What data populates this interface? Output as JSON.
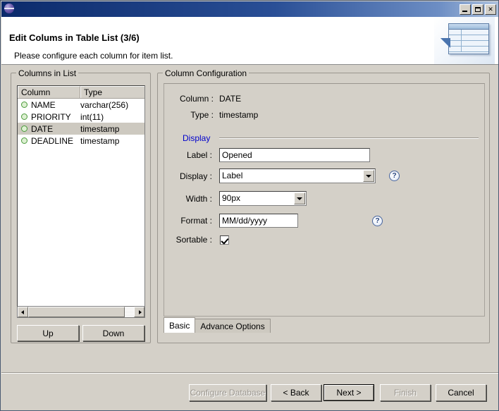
{
  "window": {
    "icon": "eclipse-globe-icon",
    "controls": {
      "minimize": "minimize-icon",
      "maximize": "maximize-icon",
      "close": "✕"
    }
  },
  "header": {
    "title": "Edit Colums in Table List (3/6)",
    "subtitle": "Please configure each column for item list.",
    "art": "table-wizard-banner-icon"
  },
  "columns_group": {
    "legend": "Columns in List",
    "table": {
      "headers": [
        "Column",
        "Type"
      ],
      "rows": [
        {
          "name": "NAME",
          "type": "varchar(256)",
          "selected": false
        },
        {
          "name": "PRIORITY",
          "type": "int(11)",
          "selected": false
        },
        {
          "name": "DATE",
          "type": "timestamp",
          "selected": true
        },
        {
          "name": "DEADLINE",
          "type": "timestamp",
          "selected": false
        }
      ]
    },
    "buttons": {
      "up": "Up",
      "down": "Down"
    }
  },
  "config_group": {
    "legend": "Column Configuration",
    "column_label": "Column :",
    "column_value": "DATE",
    "type_label": "Type :",
    "type_value": "timestamp",
    "display_section": "Display",
    "fields": {
      "label_label": "Label :",
      "label_value": "Opened",
      "display_label": "Display :",
      "display_value": "Label",
      "width_label": "Width :",
      "width_value": "90px",
      "format_label": "Format :",
      "format_value": "MM/dd/yyyy",
      "sortable_label": "Sortable :",
      "sortable_checked": true
    },
    "help_icon": "?",
    "tabs": [
      {
        "label": "Basic",
        "active": true
      },
      {
        "label": "Advance Options",
        "active": false
      }
    ]
  },
  "footer": {
    "buttons": [
      {
        "id": "configure-database",
        "label": "Configure Database",
        "enabled": false,
        "focused": false
      },
      {
        "id": "back",
        "label": "< Back",
        "enabled": true,
        "focused": false
      },
      {
        "id": "next",
        "label": "Next >",
        "enabled": true,
        "focused": true
      },
      {
        "id": "finish",
        "label": "Finish",
        "enabled": false,
        "focused": false
      },
      {
        "id": "cancel",
        "label": "Cancel",
        "enabled": true,
        "focused": false
      }
    ]
  },
  "colors": {
    "dialog_bg": "#d4d0c8",
    "title_blue": "#0b2a6b",
    "link_blue": "#0000cc",
    "selection": "#cdc9c0",
    "field_white": "#ffffff"
  }
}
